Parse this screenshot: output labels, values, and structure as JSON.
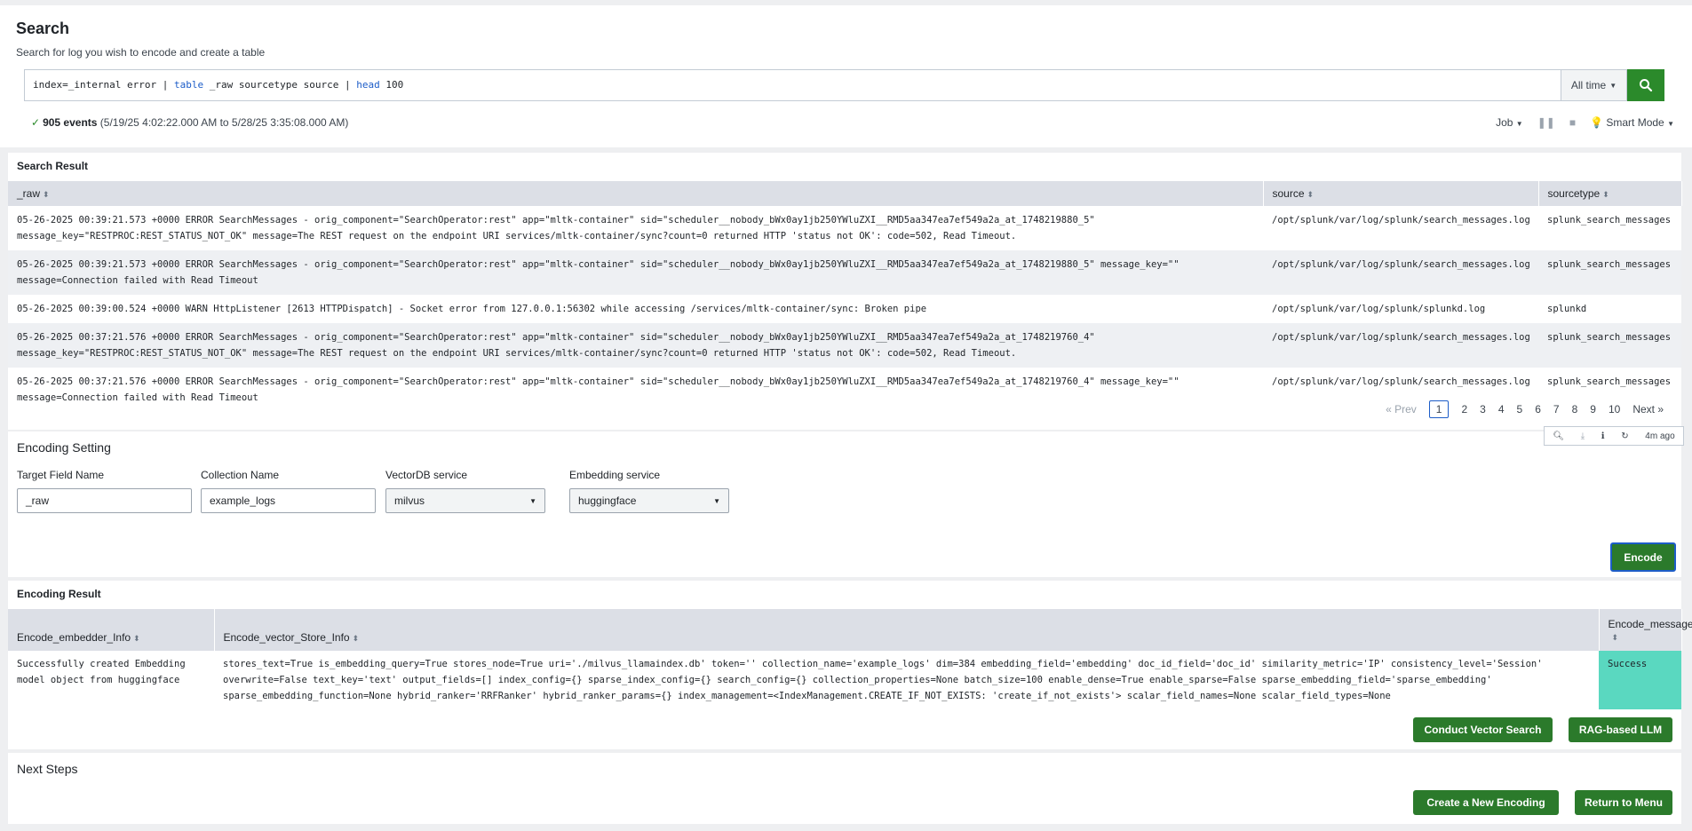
{
  "search": {
    "title": "Search",
    "subtitle": "Search for log you wish to encode and create a table",
    "query_parts": [
      "index=_internal error | ",
      "table",
      " _raw sourcetype source | ",
      "head",
      " 100"
    ],
    "time_range": "All time",
    "status_count": "905 events",
    "status_range": "(5/19/25 4:02:22.000 AM to 5/28/25 3:35:08.000 AM)",
    "job_label": "Job",
    "mode_label": "Smart Mode"
  },
  "result": {
    "title": "Search Result",
    "columns": [
      "_raw",
      "source",
      "sourcetype"
    ],
    "rows": [
      {
        "raw": "05-26-2025 00:39:21.573 +0000 ERROR SearchMessages - orig_component=\"SearchOperator:rest\" app=\"mltk-container\" sid=\"scheduler__nobody_bWx0ay1jb250YWluZXI__RMD5aa347ea7ef549a2a_at_1748219880_5\"\nmessage_key=\"RESTPROC:REST_STATUS_NOT_OK\" message=The REST request on the endpoint URI services/mltk-container/sync?count=0 returned HTTP 'status not OK': code=502, Read Timeout.",
        "source": "/opt/splunk/var/log/splunk/search_messages.log",
        "sourcetype": "splunk_search_messages"
      },
      {
        "raw": "05-26-2025 00:39:21.573 +0000 ERROR SearchMessages - orig_component=\"SearchOperator:rest\" app=\"mltk-container\" sid=\"scheduler__nobody_bWx0ay1jb250YWluZXI__RMD5aa347ea7ef549a2a_at_1748219880_5\" message_key=\"\"\nmessage=Connection failed with Read Timeout",
        "source": "/opt/splunk/var/log/splunk/search_messages.log",
        "sourcetype": "splunk_search_messages"
      },
      {
        "raw": "05-26-2025 00:39:00.524 +0000 WARN  HttpListener [2613 HTTPDispatch] - Socket error from 127.0.0.1:56302 while accessing /services/mltk-container/sync: Broken pipe",
        "source": "/opt/splunk/var/log/splunk/splunkd.log",
        "sourcetype": "splunkd"
      },
      {
        "raw": "05-26-2025 00:37:21.576 +0000 ERROR SearchMessages - orig_component=\"SearchOperator:rest\" app=\"mltk-container\" sid=\"scheduler__nobody_bWx0ay1jb250YWluZXI__RMD5aa347ea7ef549a2a_at_1748219760_4\"\nmessage_key=\"RESTPROC:REST_STATUS_NOT_OK\" message=The REST request on the endpoint URI services/mltk-container/sync?count=0 returned HTTP 'status not OK': code=502, Read Timeout.",
        "source": "/opt/splunk/var/log/splunk/search_messages.log",
        "sourcetype": "splunk_search_messages"
      },
      {
        "raw": "05-26-2025 00:37:21.576 +0000 ERROR SearchMessages - orig_component=\"SearchOperator:rest\" app=\"mltk-container\" sid=\"scheduler__nobody_bWx0ay1jb250YWluZXI__RMD5aa347ea7ef549a2a_at_1748219760_4\" message_key=\"\"\nmessage=Connection failed with Read Timeout",
        "source": "/opt/splunk/var/log/splunk/search_messages.log",
        "sourcetype": "splunk_search_messages"
      }
    ],
    "pager": {
      "prev": "« Prev",
      "pages": [
        "1",
        "2",
        "3",
        "4",
        "5",
        "6",
        "7",
        "8",
        "9",
        "10"
      ],
      "next": "Next »",
      "current": "1"
    },
    "toolbar_time": "4m ago"
  },
  "setting": {
    "title": "Encoding Setting",
    "target_label": "Target Field Name",
    "target_value": "_raw",
    "collection_label": "Collection Name",
    "collection_value": "example_logs",
    "vectordb_label": "VectorDB service",
    "vectordb_value": "milvus",
    "embedding_label": "Embedding service",
    "embedding_value": "huggingface",
    "encode_label": "Encode"
  },
  "encoding": {
    "title": "Encoding Result",
    "columns": [
      "Encode_embedder_Info",
      "Encode_vector_Store_Info",
      "Encode_message"
    ],
    "embedder_info": "Successfully created Embedding\nmodel object from huggingface",
    "store_info": "stores_text=True is_embedding_query=True stores_node=True uri='./milvus_llamaindex.db' token='' collection_name='example_logs' dim=384 embedding_field='embedding' doc_id_field='doc_id' similarity_metric='IP' consistency_level='Session'\noverwrite=False text_key='text' output_fields=[] index_config={} sparse_index_config={} search_config={} collection_properties=None batch_size=100 enable_dense=True enable_sparse=False sparse_embedding_field='sparse_embedding'\nsparse_embedding_function=None hybrid_ranker='RRFRanker' hybrid_ranker_params={} index_management=<IndexManagement.CREATE_IF_NOT_EXISTS: 'create_if_not_exists'> scalar_field_names=None scalar_field_types=None",
    "message": "Success",
    "vector_search_label": "Conduct Vector Search",
    "rag_label": "RAG-based LLM"
  },
  "next": {
    "title": "Next Steps",
    "new_encoding_label": "Create a New Encoding",
    "return_label": "Return to Menu"
  },
  "colors": {
    "accent_green": "#2b7a2b",
    "success_bg": "#5ad8c0",
    "link_blue": "#1d5dc8"
  }
}
